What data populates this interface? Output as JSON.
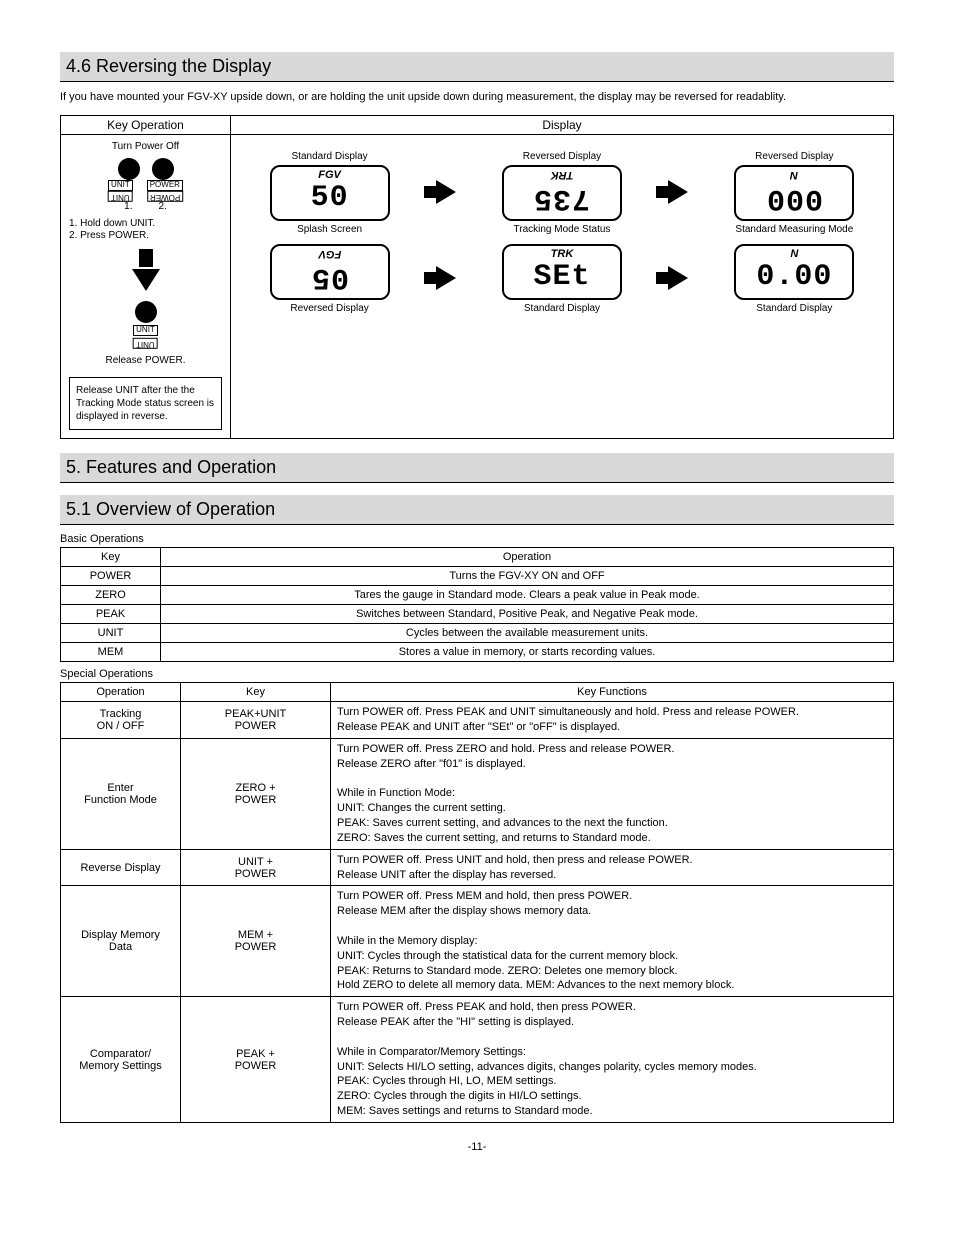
{
  "s46": {
    "heading": "4.6 Reversing the Display",
    "intro": "If you have mounted your FGV-XY upside down, or are holding the unit upside down during measurement, the display may be reversed for readablity.",
    "keyop_head": "Key Operation",
    "display_head": "Display",
    "turn_off": "Turn Power Off",
    "btn_unit": "UNIT",
    "btn_power": "POWER",
    "num1": "1.",
    "num2": "2.",
    "step1": "1. Hold down UNIT.",
    "step2": "2. Press POWER.",
    "release_power": "Release POWER.",
    "note": "Release UNIT after the the Tracking Mode status screen is displayed in reverse.",
    "row1": {
      "a_cap_top": "Standard Display",
      "a_sup": "FGV",
      "a_val": "50",
      "a_cap_bot": "Splash Screen",
      "b_cap_top": "Reversed Display",
      "b_sup": "TRK",
      "b_val": "735",
      "b_cap_bot": "Tracking Mode Status",
      "c_cap_top": "Reversed Display",
      "c_sup": "N",
      "c_val": "000",
      "c_cap_bot": "Standard Measuring Mode"
    },
    "row2": {
      "a_sup": "FGV",
      "a_val": "05",
      "a_cap_bot": "Reversed Display",
      "b_sup": "TRK",
      "b_val": "SEt",
      "b_cap_bot": "Standard Display",
      "c_sup": "N",
      "c_val": "0.00",
      "c_cap_bot": "Standard Display"
    }
  },
  "s5": {
    "heading": "5. Features and Operation"
  },
  "s51": {
    "heading": "5.1 Overview of Operation"
  },
  "basic": {
    "title": "Basic Operations",
    "h_key": "Key",
    "h_op": "Operation",
    "rows": [
      {
        "k": "POWER",
        "o": "Turns the FGV-XY ON and OFF"
      },
      {
        "k": "ZERO",
        "o": "Tares the gauge in Standard mode. Clears a peak value in Peak mode."
      },
      {
        "k": "PEAK",
        "o": "Switches between Standard, Positive Peak, and Negative Peak mode."
      },
      {
        "k": "UNIT",
        "o": "Cycles between the available measurement units."
      },
      {
        "k": "MEM",
        "o": "Stores a value in memory, or starts recording values."
      }
    ]
  },
  "special": {
    "title": "Special Operations",
    "h_op": "Operation",
    "h_key": "Key",
    "h_fn": "Key Functions",
    "rows": [
      {
        "op": "Tracking\nON / OFF",
        "key": "PEAK+UNIT\nPOWER",
        "fn": "Turn POWER off. Press PEAK and UNIT simultaneously and hold. Press and release POWER.\nRelease PEAK and UNIT after \"SEt\" or \"oFF\" is displayed."
      },
      {
        "op": "Enter\nFunction Mode",
        "key": "ZERO +\nPOWER",
        "fn": "Turn POWER off. Press ZERO and hold. Press and release POWER.\nRelease ZERO after \"f01\" is displayed.\n\nWhile in Function Mode:\nUNIT: Changes the current setting.\nPEAK: Saves current setting, and advances to the next the function.\nZERO: Saves the current setting, and returns to Standard mode."
      },
      {
        "op": "Reverse Display",
        "key": "UNIT +\nPOWER",
        "fn": "Turn POWER off. Press UNIT and hold, then press and release POWER.\nRelease UNIT after the display has reversed."
      },
      {
        "op": "Display Memory\nData",
        "key": "MEM +\nPOWER",
        "fn": "Turn POWER off. Press MEM and hold, then press POWER.\nRelease MEM after the display shows memory data.\n\nWhile in the Memory display:\nUNIT: Cycles through the statistical data for the current memory block.\nPEAK: Returns to Standard mode.  ZERO: Deletes one memory block.\nHold ZERO to delete all memory data.  MEM: Advances to the next memory block."
      },
      {
        "op": "Comparator/\nMemory Settings",
        "key": "PEAK +\nPOWER",
        "fn": "Turn POWER off. Press PEAK and hold, then press POWER.\nRelease PEAK after the \"HI\" setting is displayed.\n\nWhile in Comparator/Memory Settings:\nUNIT: Selects HI/LO setting, advances digits, changes polarity, cycles memory modes.\nPEAK: Cycles through HI, LO, MEM settings.\nZERO: Cycles through the digits in HI/LO settings.\nMEM: Saves settings and returns to Standard mode."
      }
    ]
  },
  "page": "-11-"
}
